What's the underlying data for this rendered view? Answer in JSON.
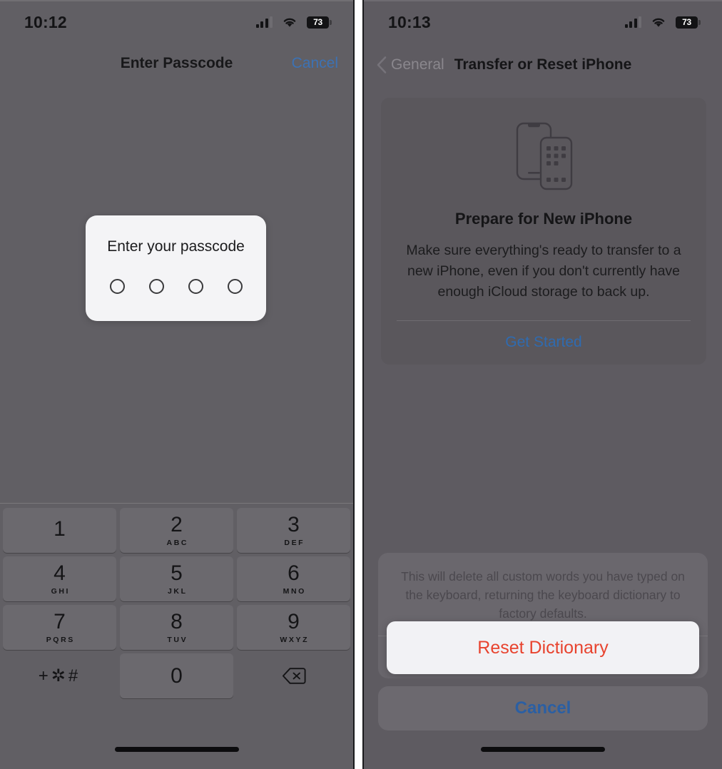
{
  "left_phone": {
    "status_bar": {
      "time": "10:12",
      "cellular_icon": "cellular-bars-icon",
      "wifi_icon": "wifi-icon",
      "battery_level": "73"
    },
    "nav": {
      "title": "Enter Passcode",
      "cancel_label": "Cancel"
    },
    "passcode_dialog": {
      "title": "Enter your passcode",
      "dot_count": 4,
      "entered_digits": 0
    },
    "keypad": {
      "keys": [
        {
          "num": "1",
          "letters": ""
        },
        {
          "num": "2",
          "letters": "ABC"
        },
        {
          "num": "3",
          "letters": "DEF"
        },
        {
          "num": "4",
          "letters": "GHI"
        },
        {
          "num": "5",
          "letters": "JKL"
        },
        {
          "num": "6",
          "letters": "MNO"
        },
        {
          "num": "7",
          "letters": "PQRS"
        },
        {
          "num": "8",
          "letters": "TUV"
        },
        {
          "num": "9",
          "letters": "WXYZ"
        },
        {
          "num": "0",
          "letters": ""
        }
      ],
      "symbols_key": "+✲#",
      "delete_icon": "delete-backward-icon"
    }
  },
  "right_phone": {
    "status_bar": {
      "time": "10:13",
      "cellular_icon": "cellular-bars-icon",
      "wifi_icon": "wifi-icon",
      "battery_level": "73"
    },
    "nav": {
      "back_chevron_icon": "chevron-left-icon",
      "back_label": "General",
      "title": "Transfer or Reset iPhone"
    },
    "prepare_card": {
      "icon": "two-iphones-icon",
      "title": "Prepare for New iPhone",
      "description": "Make sure everything's ready to transfer to a new iPhone, even if you don't currently have enough iCloud storage to back up.",
      "action_label": "Get Started"
    },
    "action_sheet": {
      "message": "This will delete all custom words you have typed on the keyboard, returning the keyboard dictionary to factory defaults.",
      "obscured_item_label": "Reset",
      "highlighted_action": "Reset Dictionary",
      "cancel_label": "Cancel"
    }
  },
  "colors": {
    "panel_background": "#615F64",
    "panel_background_right": "#5E5B61",
    "card_background": "#5A575C",
    "key_background": "#6B696E",
    "link_blue": "#3C72B4",
    "destructive_red": "#E8432E",
    "callout_white": "#F2F2F5",
    "dialog_white": "#F4F4F6"
  }
}
